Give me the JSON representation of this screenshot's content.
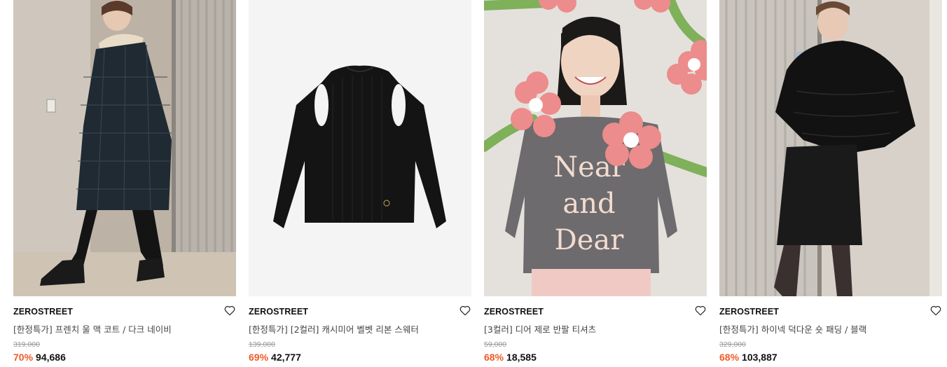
{
  "colors": {
    "discount": "#f05a28",
    "text": "#111111",
    "muted": "#999999"
  },
  "products": [
    {
      "brand": "ZEROSTREET",
      "name": "[한정특가] 프렌치 울 맥 코트 / 다크 네이비",
      "original_price": "319,000",
      "discount": "70%",
      "price": "94,686",
      "wishlist_icon": "heart-outline-icon"
    },
    {
      "brand": "ZEROSTREET",
      "name": "[한정특가] [2컬러] 캐시미어 벨벳 리본 스웨터",
      "original_price": "139,000",
      "discount": "69%",
      "price": "42,777",
      "wishlist_icon": "heart-outline-icon"
    },
    {
      "brand": "ZEROSTREET",
      "name": "[3컬러] 디어 제로 반팔 티셔츠",
      "original_price": "59,000",
      "discount": "68%",
      "price": "18,585",
      "wishlist_icon": "heart-outline-icon"
    },
    {
      "brand": "ZEROSTREET",
      "name": "[한정특가] 하이넥 덕다운 숏 패딩 / 블랙",
      "original_price": "329,000",
      "discount": "68%",
      "price": "103,887",
      "wishlist_icon": "heart-outline-icon"
    }
  ],
  "tshirt_print": [
    "Near",
    "and",
    "Dear"
  ]
}
